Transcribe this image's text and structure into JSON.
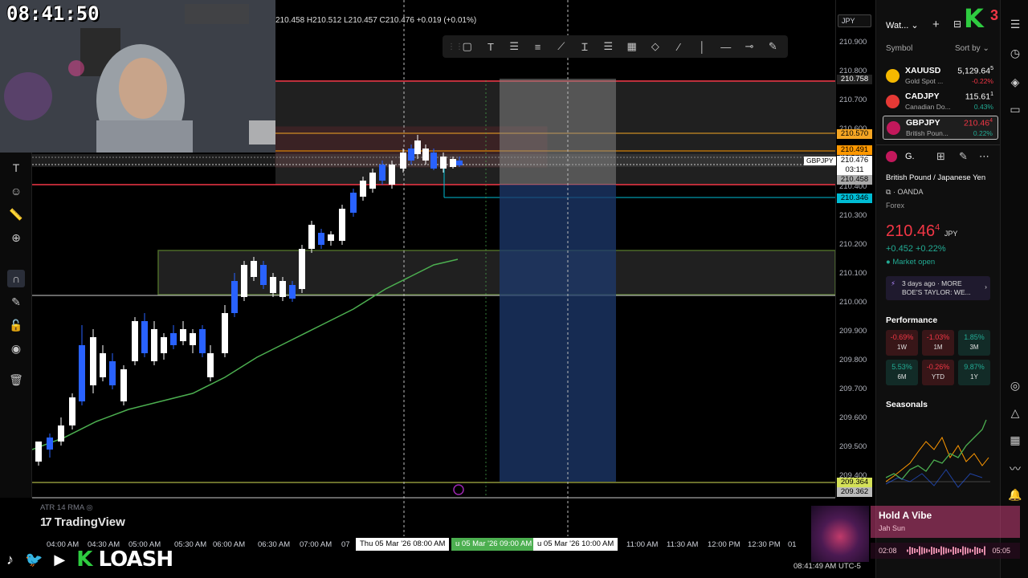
{
  "clock": "08:41:50",
  "header": {
    "ohlc": "210.458 H210.512 L210.457 C210.476 +0.019 (+0.01%)"
  },
  "price_axis": {
    "currency": "JPY",
    "ticks": [
      "210.900",
      "210.800",
      "210.700",
      "210.600",
      "210.500",
      "210.400",
      "210.300",
      "210.200",
      "210.100",
      "210.000",
      "209.900",
      "209.800",
      "209.700",
      "209.600",
      "209.500",
      "209.400"
    ],
    "tags": {
      "top_red": "210.758",
      "gold": "210.570",
      "orange": "210.491",
      "symbol": "GBPJPY",
      "current": "210.476",
      "countdown": "03:11",
      "current_low": "210.458",
      "cyan": "210.346",
      "yellow": "209.364",
      "grey": "209.362"
    }
  },
  "time_axis": {
    "labels": [
      "04:00 AM",
      "04:30 AM",
      "05:00 AM",
      "05:30 AM",
      "06:00 AM",
      "06:30 AM",
      "07:00 AM",
      "07",
      "11:00 AM",
      "11:30 AM",
      "12:00 PM",
      "12:30 PM",
      "01"
    ],
    "highlight_1": "Thu 05 Mar '26   08:00 AM",
    "highlight_2": "u 05 Mar '26   09:00 AM",
    "highlight_3": "u 05 Mar '26   10:00 AM",
    "footer_time": "08:41:49 AM UTC-5"
  },
  "indicator": {
    "atr_label": "ATR 14 RMA"
  },
  "branding": {
    "tradingview": "TradingView",
    "stream_name": "LOASH",
    "badge_num": "3"
  },
  "watchlist": {
    "title": "Wat...",
    "col_symbol": "Symbol",
    "col_sort": "Sort by",
    "items": [
      {
        "symbol": "XAUUSD",
        "desc": "Gold Spot ...",
        "price": "5,129.64",
        "price_sup": "5",
        "change": "-0.22%",
        "dir": "down"
      },
      {
        "symbol": "CADJPY",
        "desc": "Canadian Do...",
        "price": "115.61",
        "price_sup": "1",
        "change": "0.43%",
        "dir": "up"
      },
      {
        "symbol": "GBPJPY",
        "desc": "British Poun...",
        "price": "210.46",
        "price_sup": "4",
        "change": "0.22%",
        "dir": "up"
      }
    ]
  },
  "details": {
    "short": "G.",
    "name": "British Pound / Japanese Yen",
    "broker": "OANDA",
    "type": "Forex",
    "price": "210.46",
    "price_sup": "4",
    "currency": "JPY",
    "change": "+0.452  +0.22%",
    "status": "Market open",
    "news": "3 days ago · MORE BOE'S TAYLOR: WE..."
  },
  "performance": {
    "title": "Performance",
    "cells": [
      {
        "value": "-0.69%",
        "label": "1W",
        "dir": "down"
      },
      {
        "value": "-1.03%",
        "label": "1M",
        "dir": "down"
      },
      {
        "value": "1.85%",
        "label": "3M",
        "dir": "up"
      },
      {
        "value": "5.53%",
        "label": "6M",
        "dir": "up"
      },
      {
        "value": "-0.26%",
        "label": "YTD",
        "dir": "down"
      },
      {
        "value": "9.87%",
        "label": "1Y",
        "dir": "up"
      }
    ]
  },
  "seasonals": {
    "title": "Seasonals"
  },
  "music": {
    "title": "Hold A Vibe",
    "artist": "Jah Sun",
    "elapsed": "02:08",
    "duration": "05:05"
  },
  "colors": {
    "up": "#ffffff",
    "down": "#2962ff",
    "ma": "#4caf50",
    "zone_red": "#f23645",
    "zone_green": "#8bc34a"
  }
}
